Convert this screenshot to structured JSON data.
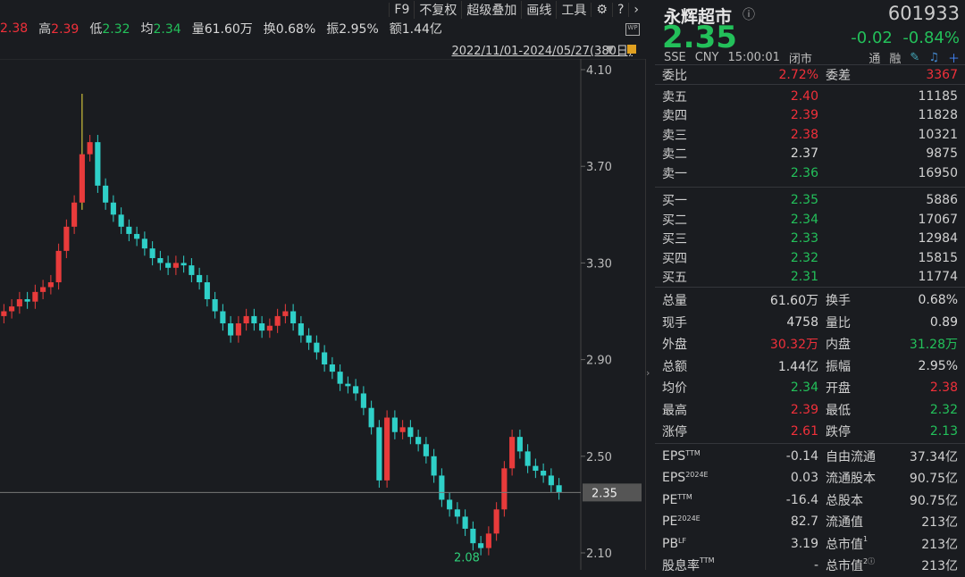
{
  "toolbar": {
    "f9": "F9",
    "adjust": "不复权",
    "overlay": "超级叠加",
    "draw": "画线",
    "tools": "工具"
  },
  "quote_strip": [
    {
      "label": "",
      "value": "2.38",
      "color": "red"
    },
    {
      "label": "高",
      "value": "2.39",
      "color": "red"
    },
    {
      "label": "低",
      "value": "2.32",
      "color": "green"
    },
    {
      "label": "均",
      "value": "2.34",
      "color": "green"
    },
    {
      "label": "量",
      "value": "61.60万",
      "color": "white"
    },
    {
      "label": "换",
      "value": "0.68%",
      "color": "white"
    },
    {
      "label": "振",
      "value": "2.95%",
      "color": "white"
    },
    {
      "label": "额",
      "value": "1.44亿",
      "color": "white"
    }
  ],
  "range": "2022/11/01-2024/05/27(380日)",
  "stock": {
    "name": "永辉超市",
    "code": "601933",
    "price": "2.35",
    "change": "-0.02",
    "change_pct": "-0.84%",
    "exchange": "SSE",
    "currency": "CNY",
    "time": "15:00:01",
    "status": "闭市",
    "tong": "通",
    "rong": "融"
  },
  "weibi": {
    "label": "委比",
    "value": "2.72%",
    "diff_label": "委差",
    "diff": "3367"
  },
  "asks": [
    {
      "label": "卖五",
      "price": "2.40",
      "vol": "11185",
      "color": "red"
    },
    {
      "label": "卖四",
      "price": "2.39",
      "vol": "11828",
      "color": "red"
    },
    {
      "label": "卖三",
      "price": "2.38",
      "vol": "10321",
      "color": "red"
    },
    {
      "label": "卖二",
      "price": "2.37",
      "vol": "9875",
      "color": "white"
    },
    {
      "label": "卖一",
      "price": "2.36",
      "vol": "16950",
      "color": "green"
    }
  ],
  "bids": [
    {
      "label": "买一",
      "price": "2.35",
      "vol": "5886",
      "color": "green"
    },
    {
      "label": "买二",
      "price": "2.34",
      "vol": "17067",
      "color": "green"
    },
    {
      "label": "买三",
      "price": "2.33",
      "vol": "12984",
      "color": "green"
    },
    {
      "label": "买四",
      "price": "2.32",
      "vol": "15815",
      "color": "green"
    },
    {
      "label": "买五",
      "price": "2.31",
      "vol": "11774",
      "color": "green"
    }
  ],
  "stats": [
    {
      "l1": "总量",
      "v1": "61.60万",
      "c1": "white",
      "l2": "换手",
      "v2": "0.68%",
      "c2": "white"
    },
    {
      "l1": "现手",
      "v1": "4758",
      "c1": "white",
      "l2": "量比",
      "v2": "0.89",
      "c2": "white"
    },
    {
      "l1": "外盘",
      "v1": "30.32万",
      "c1": "red",
      "l2": "内盘",
      "v2": "31.28万",
      "c2": "green"
    },
    {
      "l1": "总额",
      "v1": "1.44亿",
      "c1": "white",
      "l2": "振幅",
      "v2": "2.95%",
      "c2": "white"
    },
    {
      "l1": "均价",
      "v1": "2.34",
      "c1": "green",
      "l2": "开盘",
      "v2": "2.38",
      "c2": "red"
    },
    {
      "l1": "最高",
      "v1": "2.39",
      "c1": "red",
      "l2": "最低",
      "v2": "2.32",
      "c2": "green"
    },
    {
      "l1": "涨停",
      "v1": "2.61",
      "c1": "red",
      "l2": "跌停",
      "v2": "2.13",
      "c2": "green"
    }
  ],
  "fundamentals": [
    {
      "l1": "EPS",
      "s1": "TTM",
      "v1": "-0.14",
      "l2": "自由流通",
      "s2": "",
      "v2": "37.34亿"
    },
    {
      "l1": "EPS",
      "s1": "2024E",
      "v1": "0.03",
      "l2": "流通股本",
      "s2": "",
      "v2": "90.75亿"
    },
    {
      "l1": "PE",
      "s1": "TTM",
      "v1": "-16.4",
      "l2": "总股本",
      "s2": "",
      "v2": "90.75亿"
    },
    {
      "l1": "PE",
      "s1": "2024E",
      "v1": "82.7",
      "l2": "流通值",
      "s2": "",
      "v2": "213亿"
    },
    {
      "l1": "PB",
      "s1": "LF",
      "v1": "3.19",
      "l2": "总市值",
      "s2": "1",
      "v2": "213亿"
    },
    {
      "l1": "股息率",
      "s1": "TTM",
      "v1": "-",
      "l2": "总市值",
      "s2": "2ⓘ",
      "v2": "213亿"
    }
  ],
  "chart_data": {
    "type": "candlestick",
    "y_ticks": [
      "4.10",
      "3.70",
      "3.30",
      "2.90",
      "2.50",
      "2.10"
    ],
    "ylim": [
      2.05,
      4.12
    ],
    "last_price": "2.35",
    "low_label": "2.08",
    "closes": [
      3.1,
      3.12,
      3.15,
      3.14,
      3.18,
      3.2,
      3.22,
      3.35,
      3.45,
      3.55,
      3.75,
      3.8,
      3.62,
      3.55,
      3.5,
      3.45,
      3.42,
      3.4,
      3.36,
      3.32,
      3.3,
      3.28,
      3.3,
      3.29,
      3.25,
      3.22,
      3.15,
      3.1,
      3.05,
      3.0,
      3.05,
      3.08,
      3.05,
      3.02,
      3.04,
      3.08,
      3.1,
      3.05,
      3.0,
      2.97,
      2.93,
      2.88,
      2.85,
      2.8,
      2.79,
      2.76,
      2.7,
      2.62,
      2.4,
      2.66,
      2.6,
      2.62,
      2.58,
      2.55,
      2.5,
      2.42,
      2.32,
      2.28,
      2.25,
      2.2,
      2.14,
      2.12,
      2.18,
      2.28,
      2.45,
      2.58,
      2.52,
      2.46,
      2.44,
      2.42,
      2.38,
      2.35
    ],
    "highs_marked": [
      {
        "index": 10,
        "high": 4.0
      }
    ]
  }
}
